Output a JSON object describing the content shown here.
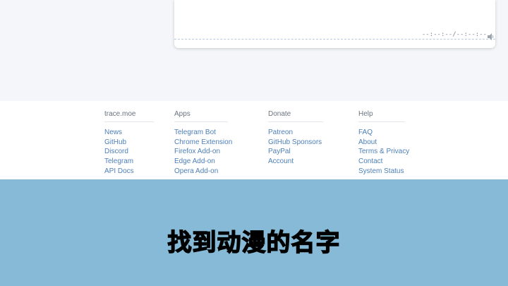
{
  "player": {
    "time_readout": "--:--:--/--:--:--",
    "volume_icon": "speaker-icon"
  },
  "footer": {
    "columns": [
      {
        "title": "trace.moe",
        "links": [
          "News",
          "GitHub",
          "Discord",
          "Telegram",
          "API Docs"
        ]
      },
      {
        "title": "Apps",
        "links": [
          "Telegram Bot",
          "Chrome Extension",
          "Firefox Add-on",
          "Edge Add-on",
          "Opera Add-on"
        ]
      },
      {
        "title": "Donate",
        "links": [
          "Patreon",
          "GitHub Sponsors",
          "PayPal",
          "Account"
        ]
      },
      {
        "title": "Help",
        "links": [
          "FAQ",
          "About",
          "Terms & Privacy",
          "Contact",
          "System Status"
        ]
      }
    ]
  },
  "banner": {
    "caption": "找到动漫的名字",
    "background_color": "#86bad6"
  }
}
